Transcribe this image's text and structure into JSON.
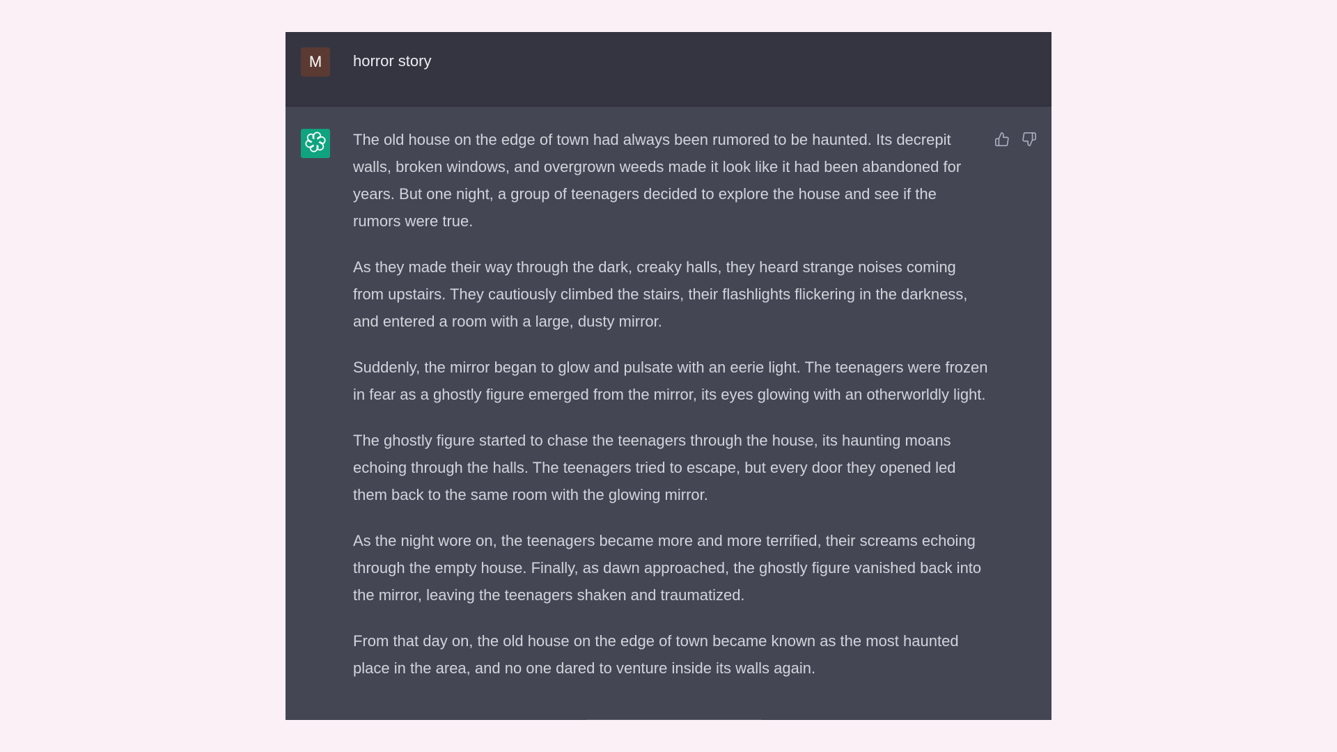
{
  "colors": {
    "page_background": "#fcf0f7",
    "user_row_background": "#343541",
    "assistant_row_background": "#444654",
    "user_avatar": "#5a3a33",
    "assistant_avatar": "#10a37f",
    "text": "#d1d5db"
  },
  "user_message": {
    "avatar_initial": "M",
    "text": "horror story"
  },
  "assistant_message": {
    "avatar_icon": "openai-logo-icon",
    "feedback_icons": [
      "thumbs-up-icon",
      "thumbs-down-icon"
    ],
    "paragraphs": [
      "The old house on the edge of town had always been rumored to be haunted. Its decrepit walls, broken windows, and overgrown weeds made it look like it had been abandoned for years. But one night, a group of teenagers decided to explore the house and see if the rumors were true.",
      "As they made their way through the dark, creaky halls, they heard strange noises coming from upstairs. They cautiously climbed the stairs, their flashlights flickering in the darkness, and entered a room with a large, dusty mirror.",
      "Suddenly, the mirror began to glow and pulsate with an eerie light. The teenagers were frozen in fear as a ghostly figure emerged from the mirror, its eyes glowing with an otherworldly light.",
      "The ghostly figure started to chase the teenagers through the house, its haunting moans echoing through the halls. The teenagers tried to escape, but every door they opened led them back to the same room with the glowing mirror.",
      "As the night wore on, the teenagers became more and more terrified, their screams echoing through the empty house. Finally, as dawn approached, the ghostly figure vanished back into the mirror, leaving the teenagers shaken and traumatized.",
      "From that day on, the old house on the edge of town became known as the most haunted place in the area, and no one dared to venture inside its walls again."
    ]
  }
}
